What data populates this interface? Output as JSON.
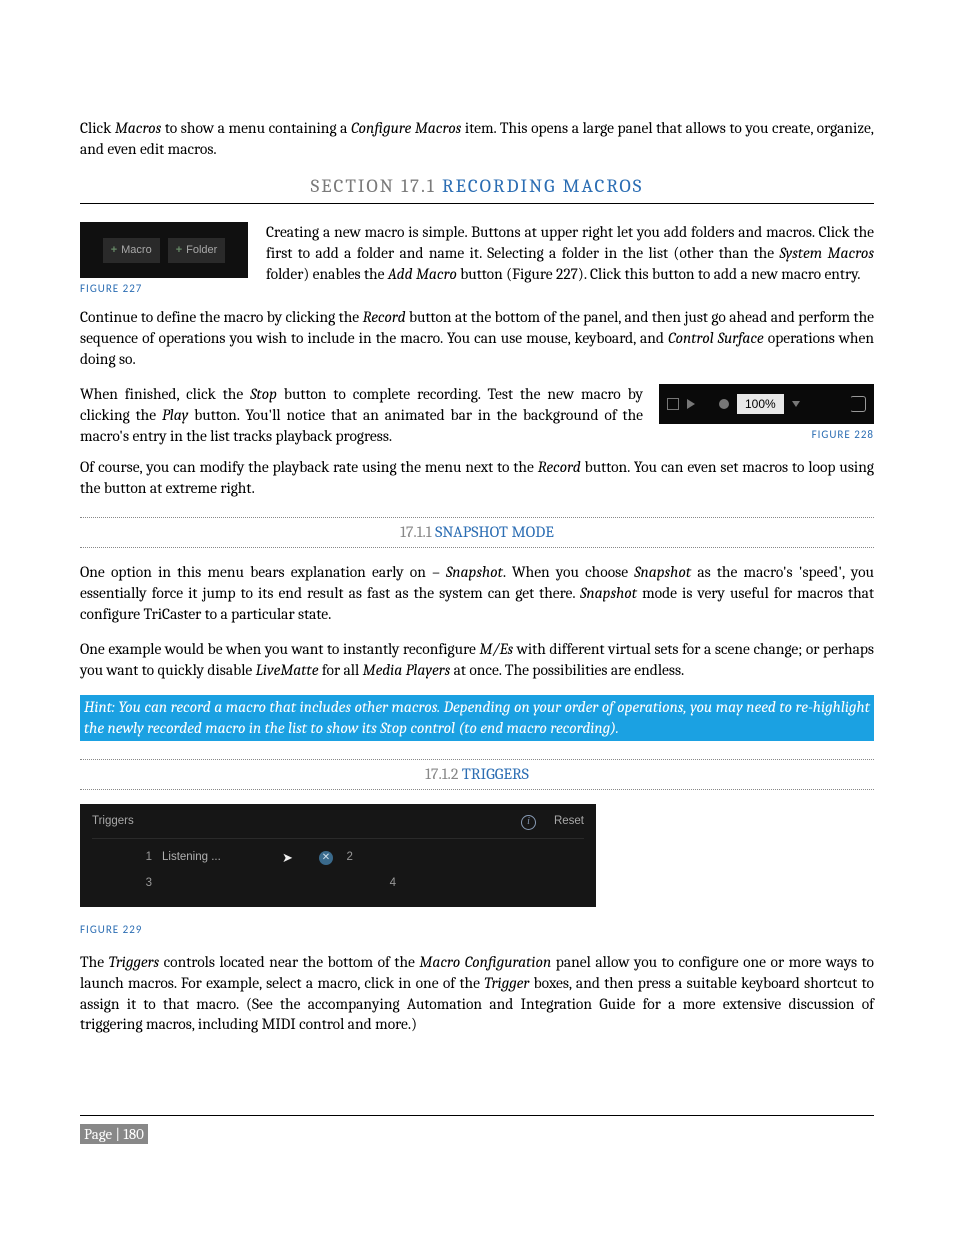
{
  "intro": {
    "text": "Click <i>Macros</i> to show a menu containing a <i>Configure Macros</i> item. This opens a large panel that allows to you create, organize, and even edit macros."
  },
  "section_17_1": {
    "prefix": "SECTION 17.1 ",
    "title": "RECORDING MACROS",
    "fig227": {
      "btn_macro": "Macro",
      "btn_folder": "Folder",
      "caption": "FIGURE 227"
    },
    "p1": "Creating a new macro is simple.  Buttons at upper right let you add folders and macros.  Click the first to add a folder and name it.  Selecting a folder in the list (other than the <i>System Macros</i> folder) enables the <i>Add Macro</i> button (Figure 227).  Click this button to add a new macro entry.",
    "p2": "Continue to define the macro by clicking the <i>Record</i> button at the bottom of the panel, and then just go ahead and perform the sequence of operations you wish to include in the macro.  You can use mouse, keyboard, and <i>Control Surface</i> operations when doing so.",
    "p3": "When finished, click the <i>Stop</i> button to complete recording. Test the new macro by clicking the <i>Play</i> button.  You'll notice that an animated bar in the background of the macro's entry in the list tracks playback progress.",
    "fig228": {
      "percent": "100%",
      "caption": "FIGURE 228"
    },
    "p4": "Of course, you can modify the playback rate using the menu next to the <i>Record</i> button.  You can even set macros to loop using the button at extreme right."
  },
  "sub_17_1_1": {
    "prefix": "17.1.1 ",
    "title": "SNAPSHOT MODE",
    "p1": "One option in this menu bears explanation early on – <i>Snapshot</i>.  When you choose <i>Snapshot</i> as the macro's 'speed', you essentially force it jump to its end result as fast as the system can get there. <i>Snapshot</i> mode is very useful for macros that configure TriCaster to a particular state.",
    "p2": "One example would be when you want to instantly reconfigure <i>M/Es</i> with different virtual sets for a scene change; or perhaps you want to quickly disable <i>LiveMatte</i> for all <i>Media Players</i> at once.  The possibilities are endless.",
    "hint": "Hint: You can record a macro that includes other macros.  Depending on your order of operations, you may need to re-highlight the newly recorded macro in the list to show its Stop control (to end macro recording)."
  },
  "sub_17_1_2": {
    "prefix": "17.1.2 ",
    "title": "TRIGGERS",
    "fig229": {
      "header_label": "Triggers",
      "reset_label": "Reset",
      "row1_num": "1",
      "row1_text": "Listening ...",
      "row2_num": "2",
      "row3_num": "3",
      "row4_num": "4",
      "caption": "FIGURE 229"
    },
    "p1": "The <i>Triggers</i> controls located near the bottom of the <i>Macro Configuration</i> panel allow you to configure one or more ways to launch macros.  For example, select a macro, click in one of the <i>Trigger</i> boxes, and then press a suitable keyboard shortcut to assign it to that macro.  (See the accompanying Automation and Integration Guide for a more extensive discussion of triggering macros, including MIDI control and more.)"
  },
  "footer": {
    "page": "Page | 180"
  }
}
